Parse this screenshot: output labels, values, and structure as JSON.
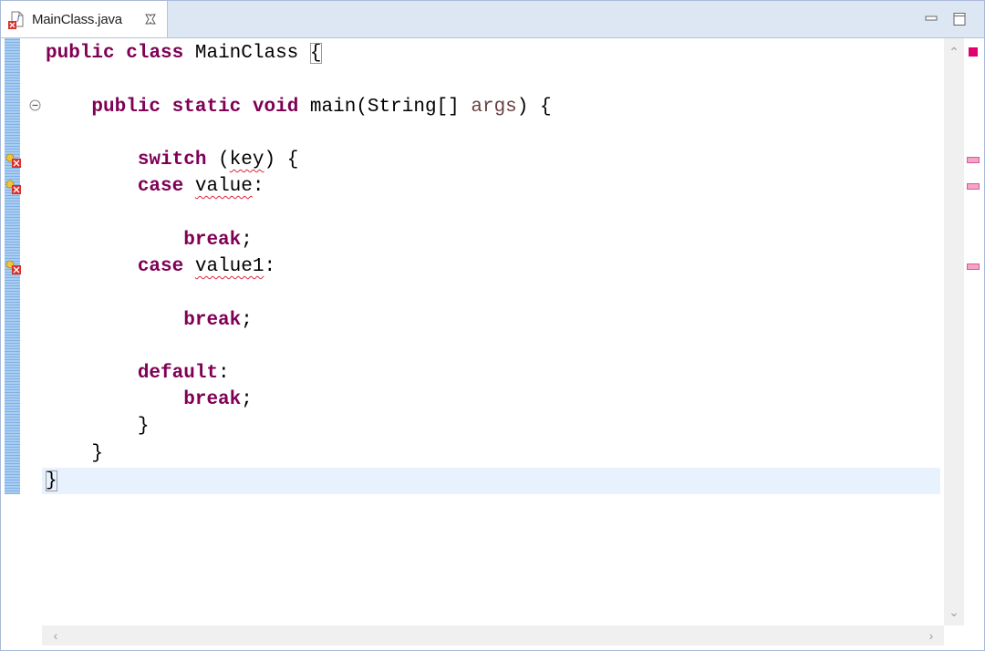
{
  "tab": {
    "label": "MainClass.java",
    "file_icon": "java-file-error-icon",
    "close_icon": "close-icon"
  },
  "window_controls": {
    "minimize_icon": "minimize-icon",
    "maximize_icon": "maximize-icon"
  },
  "code": {
    "l1": {
      "kw1": "public",
      "kw2": "class",
      "name": "MainClass",
      "brace": "{"
    },
    "l2": {
      "kw1": "public",
      "kw2": "static",
      "kw3": "void",
      "sig": "main(String[] ",
      "param": "args",
      "end": ") {"
    },
    "l3": {
      "kw": "switch",
      "open": "(",
      "var": "key",
      "close": ") {"
    },
    "l4": {
      "kw": "case",
      "val": "value",
      "colon": ":"
    },
    "l5": {
      "kw": "break",
      "semi": ";"
    },
    "l6": {
      "kw": "case",
      "val": "value1",
      "colon": ":"
    },
    "l7": {
      "kw": "break",
      "semi": ";"
    },
    "l8": {
      "kw": "default",
      "colon": ":"
    },
    "l9": {
      "kw": "break",
      "semi": ";"
    },
    "l10": "}",
    "l11": "}",
    "l12": "}"
  },
  "scroll": {
    "up": "⌃",
    "down": "⌄",
    "left": "‹",
    "right": "›"
  },
  "colors": {
    "keyword": "#7f0055",
    "param": "#6a3e3e",
    "error": "#e0243c",
    "current_line": "#e8f2fe"
  }
}
